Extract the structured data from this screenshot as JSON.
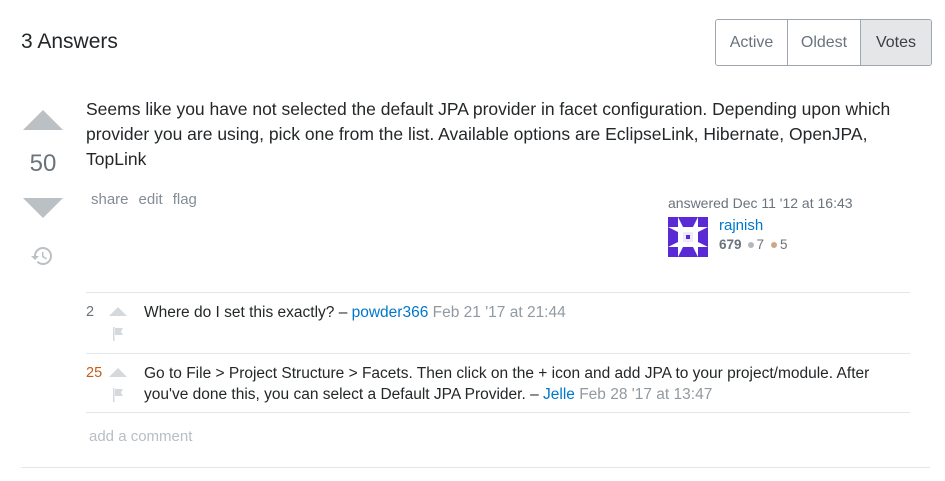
{
  "header": {
    "answers_title": "3 Answers",
    "sort_tabs": [
      "Active",
      "Oldest",
      "Votes"
    ]
  },
  "answer": {
    "vote_count": "50",
    "body": "Seems like you have not selected the default JPA provider in facet configuration. Depending upon which provider you are using, pick one from the list. Available options are EclipseLink, Hibernate, OpenJPA, TopLink",
    "menu": {
      "share": "share",
      "edit": "edit",
      "flag": "flag"
    },
    "user": {
      "answered_label": "answered Dec 11 '12 at 16:43",
      "name": "rajnish",
      "reputation": "679",
      "silver_badges": "7",
      "bronze_badges": "5"
    }
  },
  "comments": [
    {
      "score": "2",
      "text": "Where do I set this exactly? – ",
      "user": "powder366",
      "date": "Feb 21 '17 at 21:44"
    },
    {
      "score": "25",
      "text": "Go to File > Project Structure > Facets. Then click on the + icon and add JPA to your project/module. After you've done this, you can select a Default JPA Provider. – ",
      "user": "Jelle",
      "date": "Feb 28 '17 at 13:47"
    }
  ],
  "add_comment_label": "add a comment",
  "colors": {
    "link": "#0077cc",
    "muted": "#6a737c",
    "high_score": "#c45c1a",
    "avatar": "#5a2bd4"
  },
  "icons": [
    "vote-up-icon",
    "vote-down-icon",
    "history-icon",
    "flag-icon",
    "avatar-identicon"
  ]
}
